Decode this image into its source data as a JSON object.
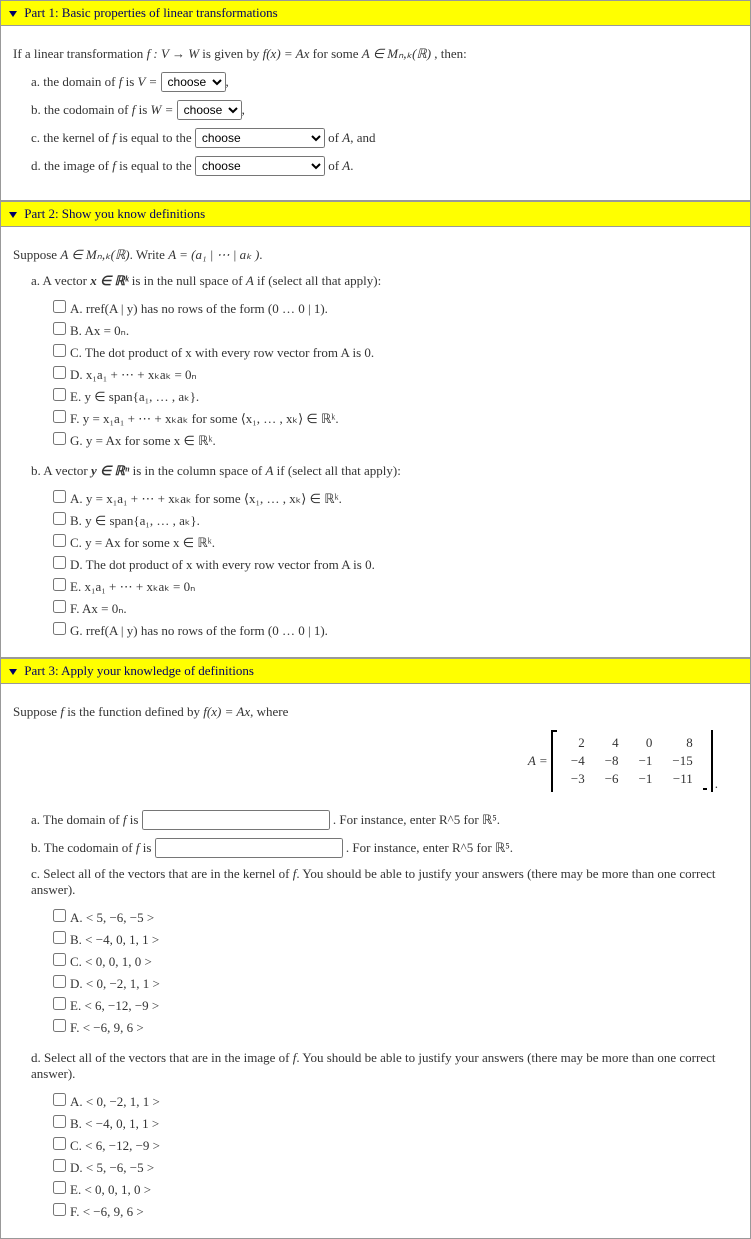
{
  "part1": {
    "title": "Part 1: Basic properties of linear transformations",
    "intro_a": "If a linear transformation ",
    "intro_b": " is given by ",
    "intro_c": " for some ",
    "intro_d": ", then:",
    "f_map": "f : V → W",
    "f_eq": "f(x) = Ax",
    "A_in": "A ∈ Mₙ,ₖ(ℝ)",
    "a_pre": "a. the domain of ",
    "a_mid": " is ",
    "a_eq": "V = ",
    "b_pre": "b. the codomain of ",
    "b_mid": " is ",
    "b_eq": "W = ",
    "c_pre": "c. the kernel of ",
    "c_mid": " is equal to the ",
    "c_post": " of ",
    "c_tail": ", and",
    "d_pre": "d. the image of ",
    "d_mid": " is equal to the ",
    "d_post": " of ",
    "d_tail": ".",
    "f": "f",
    "A": "A",
    "choose": "choose"
  },
  "part2": {
    "title": "Part 2: Show you know definitions",
    "suppose_a": "Suppose ",
    "A_in": "A ∈ Mₙ,ₖ(ℝ)",
    "write": ". Write ",
    "A_eq": "A = (a₁ | ⋯ | aₖ )",
    "period": ".",
    "a_intro_a": "a. A vector ",
    "x_in": "x ∈ ℝᵏ",
    "a_intro_b": " is in the null space of ",
    "a_intro_c": " if (select all that apply):",
    "b_intro_a": "b. A vector ",
    "y_in": "y ∈ ℝⁿ",
    "b_intro_b": " is in the column space of ",
    "b_intro_c": " if (select all that apply):",
    "A": "A",
    "optsA": [
      "A. rref(A | y) has no rows of the form (0 … 0 | 1).",
      "B. Ax = 0ₙ.",
      "C. The dot product of x with every row vector from A is 0.",
      "D. x₁a₁ + ⋯ + xₖaₖ = 0ₙ",
      "E. y ∈ span{a₁, … , aₖ}.",
      "F. y = x₁a₁ + ⋯ + xₖaₖ for some ⟨x₁, … , xₖ⟩ ∈ ℝᵏ.",
      "G. y = Ax for some x ∈ ℝᵏ."
    ],
    "optsB": [
      "A. y = x₁a₁ + ⋯ + xₖaₖ for some ⟨x₁, … , xₖ⟩ ∈ ℝᵏ.",
      "B. y ∈ span{a₁, … , aₖ}.",
      "C. y = Ax for some x ∈ ℝᵏ.",
      "D. The dot product of x with every row vector from A is 0.",
      "E. x₁a₁ + ⋯ + xₖaₖ = 0ₙ",
      "F. Ax = 0ₙ.",
      "G. rref(A | y) has no rows of the form (0 … 0 | 1)."
    ]
  },
  "part3": {
    "title": "Part 3: Apply your knowledge of definitions",
    "suppose_a": "Suppose ",
    "suppose_b": " is the function defined by ",
    "suppose_c": ", where",
    "f": "f",
    "f_eq": "f(x) = Ax",
    "A_eq": "A = ",
    "matrix": [
      [
        "2",
        "4",
        "0",
        "8"
      ],
      [
        "−4",
        "−8",
        "−1",
        "−15"
      ],
      [
        "−3",
        "−6",
        "−1",
        "−11"
      ]
    ],
    "a_pre": "a. The domain of ",
    "a_post": " is ",
    "hint_a": ". For instance, enter R^5 for ",
    "R5": "ℝ⁵",
    "b_pre": "b. The codomain of ",
    "b_post": " is ",
    "hint_b": ". For instance, enter R^5 for ",
    "c_text_a": "c. Select all of the vectors that are in the kernel of ",
    "c_text_b": ". You should be able to justify your answers (there may be more than one correct answer).",
    "d_text_a": "d. Select all of the vectors that are in the image of ",
    "d_text_b": ". You should be able to justify your answers (there may be more than one correct answer).",
    "optsC": [
      "A. < 5, −6, −5 >",
      "B. < −4, 0, 1, 1 >",
      "C. < 0, 0, 1, 0 >",
      "D. < 0, −2, 1, 1 >",
      "E. < 6, −12, −9 >",
      "F. < −6, 9, 6 >"
    ],
    "optsD": [
      "A. < 0, −2, 1, 1 >",
      "B. < −4, 0, 1, 1 >",
      "C. < 6, −12, −9 >",
      "D. < 5, −6, −5 >",
      "E. < 0, 0, 1, 0 >",
      "F. < −6, 9, 6 >"
    ],
    "period": "."
  }
}
